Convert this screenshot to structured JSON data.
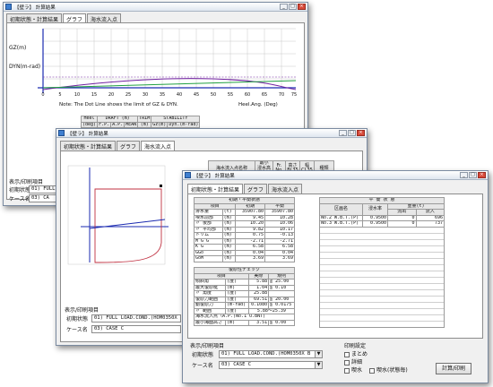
{
  "window1": {
    "title": "【壁ラ】 計算結果",
    "tabs": [
      "初期状態・計算結果",
      "グラフ",
      "海水流入点"
    ],
    "chart": {
      "gz_label": "GZ(m)",
      "dyn_label": "DYN(m-rad)",
      "x_ticks": [
        "0",
        "5",
        "10",
        "15",
        "20",
        "25",
        "30",
        "35",
        "40",
        "45",
        "50",
        "55",
        "60",
        "65",
        "70",
        "75"
      ],
      "note": "Note: The Dot Line shows the limit of GZ & DYN.",
      "x_axis_label": "Heel.Ang. (Deg)"
    },
    "table_headers": [
      "Heel",
      "DRAFT (m)",
      "TRIM",
      "STABILITY"
    ],
    "table_sub": [
      "(deg)",
      "F.P.",
      "A.P.",
      "MEAN",
      "(m)",
      "Gz(m)",
      "Dyn.(m-rad)"
    ],
    "display_group": "表示/印刷項目",
    "init_label": "初期状態",
    "init_value": "01) FULL LOAD.COND.(HOM0350",
    "case_label": "ケース名",
    "case_value": "03) CA"
  },
  "window2": {
    "title": "【壁ラ】 計算結果",
    "tabs": [
      "初期状態・計算結果",
      "グラフ",
      "海水流入点"
    ],
    "header_cols": [
      "海水流入点名称",
      "最小\n浸水高さ",
      "Fr.\nNo.",
      "高さ\nBL35",
      "幅\nCL35",
      "種類"
    ],
    "display_group": "表示/印刷項目",
    "init_label": "初期状態",
    "init_value": "01) FULL LOAD.COND.(HOM0350X",
    "case_label": "ケース名",
    "case_value": "03) CASE C"
  },
  "window3": {
    "title": "【壁ラ】 計算結果",
    "tabs": [
      "初期状態・計算結果",
      "グラフ",
      "海水流入点"
    ],
    "left_header": "初期・平衡状態",
    "left_cols": [
      "項目",
      "初期",
      "平衡"
    ],
    "left_rows": [
      [
        "排水量",
        "(t)",
        "35907.80",
        "35907.80"
      ],
      [
        "喫水前部",
        "(m)",
        "9.45",
        "10.28"
      ],
      [
        "〃 後部",
        "(m)",
        "10.20",
        "10.06"
      ],
      [
        "〃 平均部",
        "(m)",
        "9.82",
        "10.17"
      ],
      [
        "トリム",
        "(m)",
        "0.75",
        "-0.13"
      ],
      [
        "M G G",
        "(m)",
        "-2.71",
        "-2.71"
      ],
      [
        "K G",
        "(m)",
        "6.58",
        "6.58"
      ],
      [
        "GGo",
        "(m)",
        "0.04",
        "0.04"
      ],
      [
        "GoM",
        "(m)",
        "3.69",
        "3.69"
      ]
    ],
    "check_header": "復原性チェック",
    "check_cols": [
      "項目",
      "実際",
      "規則"
    ],
    "check_rows": [
      [
        "傾斜角",
        "(度)",
        "5.88",
        "≦ 25.00"
      ],
      [
        "最大復原梃",
        "(m)",
        "1.04",
        "≧ 0.10"
      ],
      [
        "〃 角度",
        "(度)",
        "25.88",
        ""
      ],
      [
        "復原力範囲",
        "(度)",
        "69.51",
        "≧ 20.00"
      ],
      [
        "動復原力",
        "(m-rad)",
        "0.1080",
        "≧ 0.0175"
      ],
      [
        "〃 範囲",
        "(度)",
        "5.88〜25.39",
        ""
      ],
      [
        "海水流入点（A.P.(No.1 U.BNT)",
        "",
        "",
        ""
      ],
      [
        "最小海面高さ",
        "(m)",
        "3.51",
        "≧ 0.00"
      ]
    ],
    "right_header": "平 衡 状 態",
    "right_cols": [
      "区画名",
      "浸水率",
      "重量(t)",
      "流出",
      "流入"
    ],
    "right_rows": [
      [
        "No.2 W.B.T.(P)",
        "0.9500",
        "0",
        "696"
      ],
      [
        "No.3 W.B.T.(P)",
        "0.9500",
        "0",
        "737"
      ]
    ],
    "display_group": "表示/印刷項目",
    "init_label": "初期状態",
    "init_value": "01) FULL LOAD.COND.(HOM0350X B",
    "case_label": "ケース名",
    "case_value": "03) CASE C",
    "print_group": "印刷設定",
    "print_opts": [
      "まとめ",
      "詳細",
      "喫水",
      "喫水(状態毎)"
    ],
    "calc_button": "計算/印刷"
  },
  "colors": {
    "gz_curve": "#7020a0",
    "dyn_curve": "#20a040",
    "flood_curve": "#c03040",
    "axis": "#1a2ab0"
  }
}
